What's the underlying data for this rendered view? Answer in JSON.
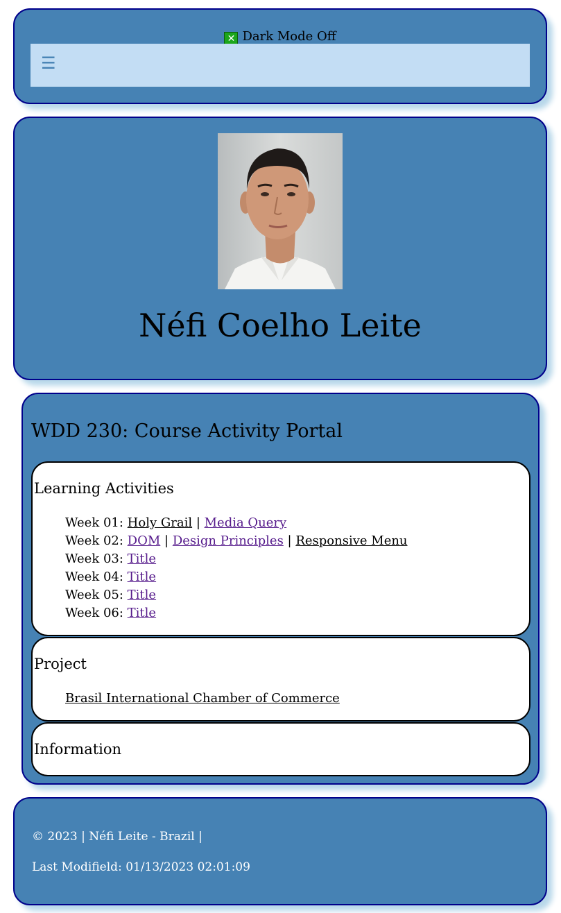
{
  "header": {
    "dark_mode_label": "Dark Mode Off",
    "menu_icon": "☰"
  },
  "hero": {
    "name": "Néfi Coelho Leite",
    "portrait_icon": "person-portrait"
  },
  "main": {
    "title": "WDD 230: Course Activity Portal",
    "learning": {
      "heading": "Learning Activities",
      "weeks": [
        {
          "label": "Week 01: ",
          "links": [
            "Holy Grail",
            "Media Query"
          ]
        },
        {
          "label": "Week 02: ",
          "links": [
            "DOM",
            "Design Principles",
            "Responsive Menu"
          ]
        },
        {
          "label": "Week 03: ",
          "links": [
            "Title"
          ]
        },
        {
          "label": "Week 04: ",
          "links": [
            "Title"
          ]
        },
        {
          "label": "Week 05: ",
          "links": [
            "Title"
          ]
        },
        {
          "label": "Week 06: ",
          "links": [
            "Title"
          ]
        }
      ],
      "separator": " | "
    },
    "project": {
      "heading": "Project",
      "link": "Brasil International Chamber of Commerce"
    },
    "information": {
      "heading": "Information"
    }
  },
  "footer": {
    "copyright": "© 2023 | Néfi Leite - Brazil |",
    "last_modified": "Last Modifield: 01/13/2023 02:01:09"
  },
  "colors": {
    "card_bg": "#4682b4",
    "card_border": "#00008b",
    "nav_bg": "#c3ddf4",
    "link_visited": "#551a8b"
  }
}
